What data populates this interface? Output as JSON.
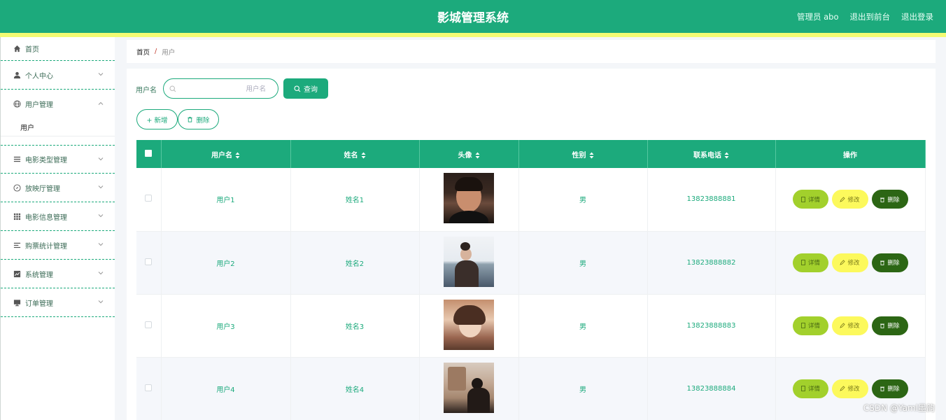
{
  "header": {
    "title": "影城管理系统",
    "admin_label": "管理员 abo",
    "back_to_admin": "退出到前台",
    "logout": "退出登录"
  },
  "sidebar": {
    "items": [
      {
        "label": "首页",
        "icon": "home-icon"
      },
      {
        "label": "个人中心",
        "icon": "user-icon"
      },
      {
        "label": "用户管理",
        "icon": "globe-icon",
        "expanded": true,
        "children": [
          "用户"
        ]
      },
      {
        "label": "电影类型管理",
        "icon": "list-icon"
      },
      {
        "label": "放映厅管理",
        "icon": "compass-icon"
      },
      {
        "label": "电影信息管理",
        "icon": "grid-icon"
      },
      {
        "label": "购票统计管理",
        "icon": "bars-icon"
      },
      {
        "label": "系统管理",
        "icon": "chart-icon"
      },
      {
        "label": "订单管理",
        "icon": "monitor-icon"
      }
    ]
  },
  "breadcrumb": {
    "home": "首页",
    "separator": "/",
    "current": "用户"
  },
  "search": {
    "label": "用户名",
    "placeholder": "用户名",
    "button": "查询"
  },
  "actions": {
    "add": "+ 新增",
    "delete": "删除"
  },
  "table": {
    "headers": [
      "用户名",
      "姓名",
      "头像",
      "性别",
      "联系电话",
      "操作"
    ],
    "row_buttons": {
      "detail": "详情",
      "edit": "修改",
      "delete": "删除"
    },
    "rows": [
      {
        "username": "用户1",
        "name": "姓名1",
        "gender": "男",
        "phone": "13823888881"
      },
      {
        "username": "用户2",
        "name": "姓名2",
        "gender": "男",
        "phone": "13823888882"
      },
      {
        "username": "用户3",
        "name": "姓名3",
        "gender": "男",
        "phone": "13823888883"
      },
      {
        "username": "用户4",
        "name": "姓名4",
        "gender": "男",
        "phone": "13823888884"
      }
    ]
  },
  "watermark": "CSDN @Yaml墨韵",
  "colors": {
    "primary": "#1caa7c",
    "accent_strip": "#f3fb73",
    "detail_btn": "#a2d02c",
    "edit_btn": "#fcf95c",
    "delete_btn": "#2c6614"
  }
}
